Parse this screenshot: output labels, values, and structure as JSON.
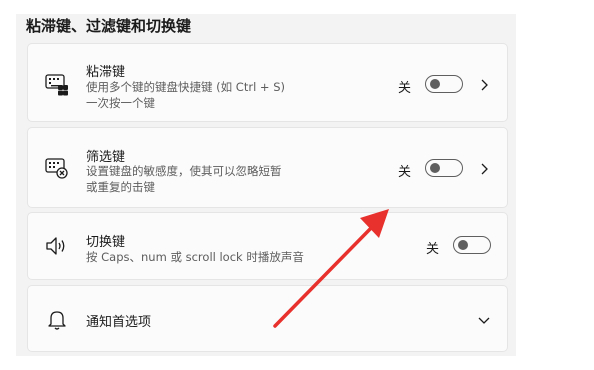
{
  "section": {
    "title": "粘滞键、过滤键和切换键"
  },
  "sticky_keys": {
    "title": "粘滞键",
    "desc_line1": "使用多个键的键盘快捷键 (如 Ctrl + S)",
    "desc_line2": "一次按一个键",
    "state_label": "关",
    "toggle_on": false
  },
  "filter_keys": {
    "title": "筛选键",
    "desc_line1": "设置键盘的敏感度，使其可以忽略短暂",
    "desc_line2": "或重复的击键",
    "state_label": "关",
    "toggle_on": false
  },
  "toggle_keys": {
    "title": "切换键",
    "desc_line1": "按 Caps、num 或 scroll lock 时播放声音",
    "state_label": "关",
    "toggle_on": false
  },
  "notifications": {
    "title": "通知首选项"
  },
  "colors": {
    "annotation_arrow": "#e8302c",
    "toggle_off": "#5f5f5f"
  },
  "icons": {
    "sticky_keys": "keyboard-sticky-icon",
    "filter_keys": "keyboard-filter-icon",
    "toggle_keys": "speaker-icon",
    "notifications": "bell-icon",
    "expand": "chevron-right-icon",
    "collapse": "chevron-down-icon"
  }
}
